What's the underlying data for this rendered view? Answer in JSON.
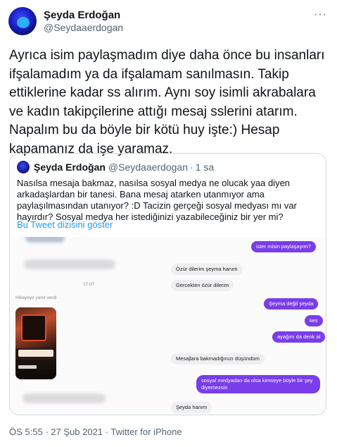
{
  "author": {
    "name": "Şeyda Erdoğan",
    "handle": "@Seydaaerdogan"
  },
  "menu_glyph": "···",
  "tweet_text": "Ayrıca isim paylaşmadım diye daha önce bu insanları ifşalamadım ya da ifşalamam sanılmasın. Takip ettiklerine kadar ss alırım. Aynı soy isimli akrabalara ve kadın takipçilerine attığı mesaj sslerini atarım. Napalım bu da böyle bir kötü huy işte:) Hesap kapamanız da işe yaramaz.",
  "quoted": {
    "name": "Şeyda Erdoğan",
    "handle": "@Seydaaerdogan",
    "dot": "·",
    "age": "1 sa",
    "text": "Nasılsa mesaja bakmaz, nasılsa sosyal medya ne olucak yaa diyen arkadaşlardan bir tanesi. Bana mesaj atarken utanmıyor ama paylaşılmasından utanıyor? :D Tacizin gerçeği sosyal medyası mı var hayırdır? Sosyal medya her istediğinizi yazabileceğiniz bir yer mi?",
    "thread_link": "Bu Tweet dizisini göster"
  },
  "chat": {
    "time_separator": "17:07",
    "story_reply_label": "Hikayeye yanıt verdi",
    "messages": [
      {
        "dir": "out",
        "text": "ister misin paylaşayım?"
      },
      {
        "dir": "in",
        "text": "Özür dilerim şeyma hanım"
      },
      {
        "dir": "in",
        "text": "Gercekten özür dilerim"
      },
      {
        "dir": "out",
        "text": "Şeyma değil şeyda"
      },
      {
        "dir": "out",
        "text": "kes"
      },
      {
        "dir": "out",
        "text": "ayağını da denk al"
      },
      {
        "dir": "in",
        "text": "Mesajlara bakmadığınızı düşündüm"
      },
      {
        "dir": "out",
        "text": "sosyal medyadan da olsa kimseye böyle bir şey diyemezsin"
      },
      {
        "dir": "in",
        "text": "Şeyda hanım"
      }
    ]
  },
  "footer": {
    "time": "ÖS 5:55",
    "sep1": "·",
    "date": "27 Şub 2021",
    "sep2": "·",
    "source": "Twitter for iPhone"
  },
  "colors": {
    "primary_text": "#0f1419",
    "secondary_text": "#536471",
    "link": "#1d9bf0",
    "sent_bubble": "#7a3dea",
    "received_bubble": "#efeff1"
  },
  "icons": [
    "avatar",
    "more-menu-icon"
  ]
}
